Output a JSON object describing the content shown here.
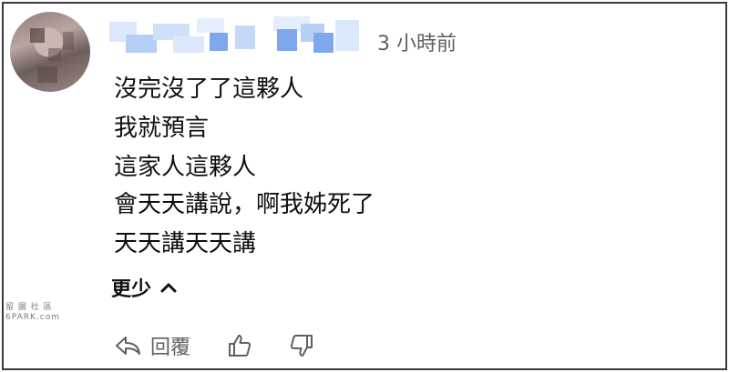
{
  "comment": {
    "time": "3 小時前",
    "lines": [
      "沒完沒了了這夥人",
      "我就預言",
      "這家人這夥人",
      "會天天講說，啊我姊死了",
      "天天講天天講"
    ],
    "show_less_label": "更少"
  },
  "actions": {
    "reply_label": "回覆"
  },
  "watermark": {
    "line1": "留 園 社 區",
    "line2": "6PARK.com"
  },
  "colors": {
    "blur_light": "#dbe8fb",
    "blur_mid": "#b6cff7",
    "blur_dark": "#7fa7ec",
    "text_primary": "#0f0f0f",
    "text_secondary": "#606060"
  }
}
